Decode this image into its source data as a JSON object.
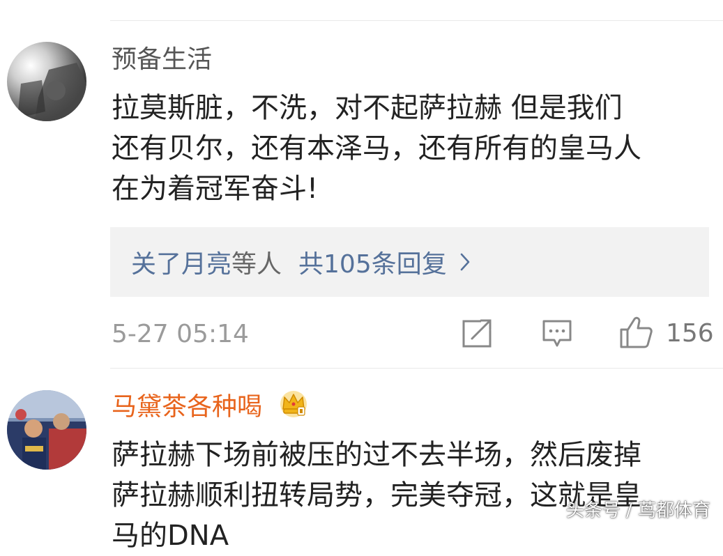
{
  "comments": [
    {
      "username": "预备生活",
      "text_lines": [
        "拉莫斯脏，不洗，对不起萨拉赫 但是我们",
        "还有贝尔，还有本泽马，还有所有的皇马人",
        "在为着冠军奋斗!"
      ],
      "replies": {
        "names": "关了月亮",
        "middle": "等人",
        "count_label": "共105条回复"
      },
      "time": "5-27 05:14",
      "likes": "156",
      "username_color": "#555555"
    },
    {
      "username": "马黛茶各种喝",
      "text_lines": [
        "萨拉赫下场前被压的过不去半场，然后废掉",
        "萨拉赫顺利扭转局势，完美夺冠，这就是皇",
        "马的DNA"
      ],
      "username_color": "#e8641c",
      "badge": "crown-icon"
    }
  ],
  "watermark": "头条号 / 茑都体育"
}
